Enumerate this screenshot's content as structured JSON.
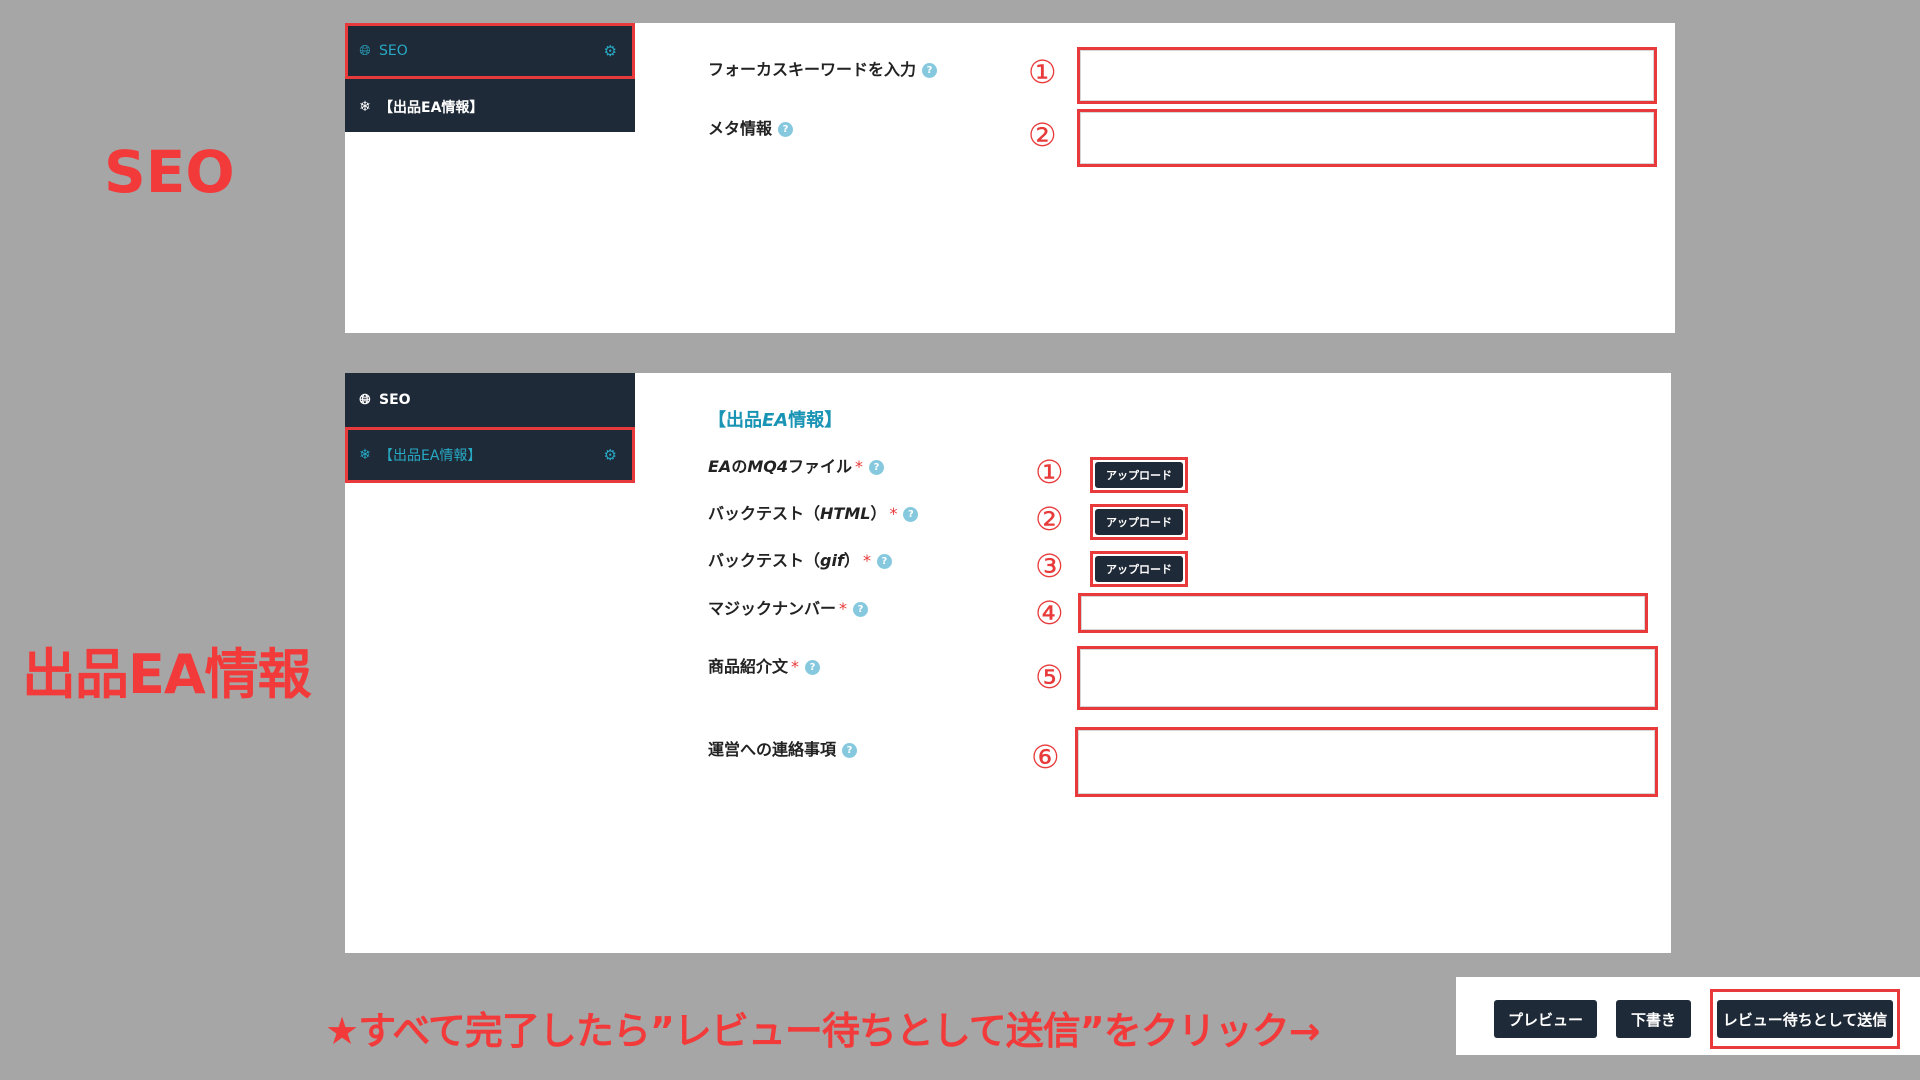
{
  "labels": {
    "seo_heading": "SEO",
    "ea_heading": "出品EA情報"
  },
  "seo_panel": {
    "sidebar": [
      {
        "label": "SEO",
        "icon": "globe-icon",
        "active": true
      },
      {
        "label": "【出品EA情報】",
        "icon": "snowflake-icon",
        "active": false
      }
    ],
    "fields": [
      {
        "label": "フォーカスキーワードを入力",
        "number": "①",
        "value": ""
      },
      {
        "label": "メタ情報",
        "number": "②",
        "value": ""
      }
    ]
  },
  "ea_panel": {
    "sidebar": [
      {
        "label": "SEO",
        "icon": "globe-icon",
        "active": false
      },
      {
        "label": "【出品EA情報】",
        "icon": "snowflake-icon",
        "active": true
      }
    ],
    "section_title_prefix": "【出品",
    "section_title_italic": "EA",
    "section_title_suffix": "情報】",
    "fields": [
      {
        "label_italic": "EA",
        "label_mid": "の",
        "label_italic2": "MQ4",
        "label_suffix": "ファイル",
        "required": "*",
        "number": "①",
        "button": "アップロード"
      },
      {
        "label_prefix": "バックテスト（",
        "label_italic": "HTML",
        "label_suffix": "）",
        "required": "*",
        "number": "②",
        "button": "アップロード"
      },
      {
        "label_prefix": "バックテスト（",
        "label_italic": "gif",
        "label_suffix": "）",
        "required": "*",
        "number": "③",
        "button": "アップロード"
      },
      {
        "label": "マジックナンバー",
        "required": "*",
        "number": "④",
        "value": ""
      },
      {
        "label": "商品紹介文",
        "required": "*",
        "number": "⑤",
        "value": ""
      },
      {
        "label": "運営への連絡事項",
        "number": "⑥",
        "value": ""
      }
    ]
  },
  "cta": "★すべて完了したら”レビュー待ちとして送信”をクリック→",
  "action_bar": {
    "preview": "プレビュー",
    "draft": "下書き",
    "submit": "レビュー待ちとして送信"
  },
  "colors": {
    "accent_red": "#e83a3a",
    "sidebar_bg": "#1f2a38",
    "teal": "#27a9c4"
  }
}
